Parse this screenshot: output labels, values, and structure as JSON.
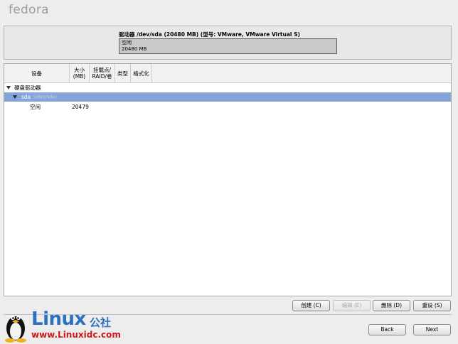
{
  "header": {
    "logo_text": "fedora"
  },
  "drive": {
    "title": "驱动器 /dev/sda (20480 MB) (型号: VMware, VMware Virtual S)",
    "free_label": "空闲",
    "free_size": "20480 MB"
  },
  "table": {
    "columns": [
      "设备",
      "大小\n(MB)",
      "挂载点/\nRAID/卷",
      "类型",
      "格式化"
    ],
    "group_label": "硬盘驱动器",
    "disk_name": "sda",
    "disk_path": "(/dev/sda)",
    "rows": [
      {
        "device": "空闲",
        "size": "20479"
      }
    ]
  },
  "actions": {
    "create": "创建 (C)",
    "edit": "编辑 (E)",
    "delete": "删除 (D)",
    "reset": "重设 (S)"
  },
  "nav": {
    "back": "Back",
    "next": "Next"
  },
  "watermark": {
    "title": "Linux",
    "cn": "公社",
    "url": "www.Linuxidc.com"
  }
}
